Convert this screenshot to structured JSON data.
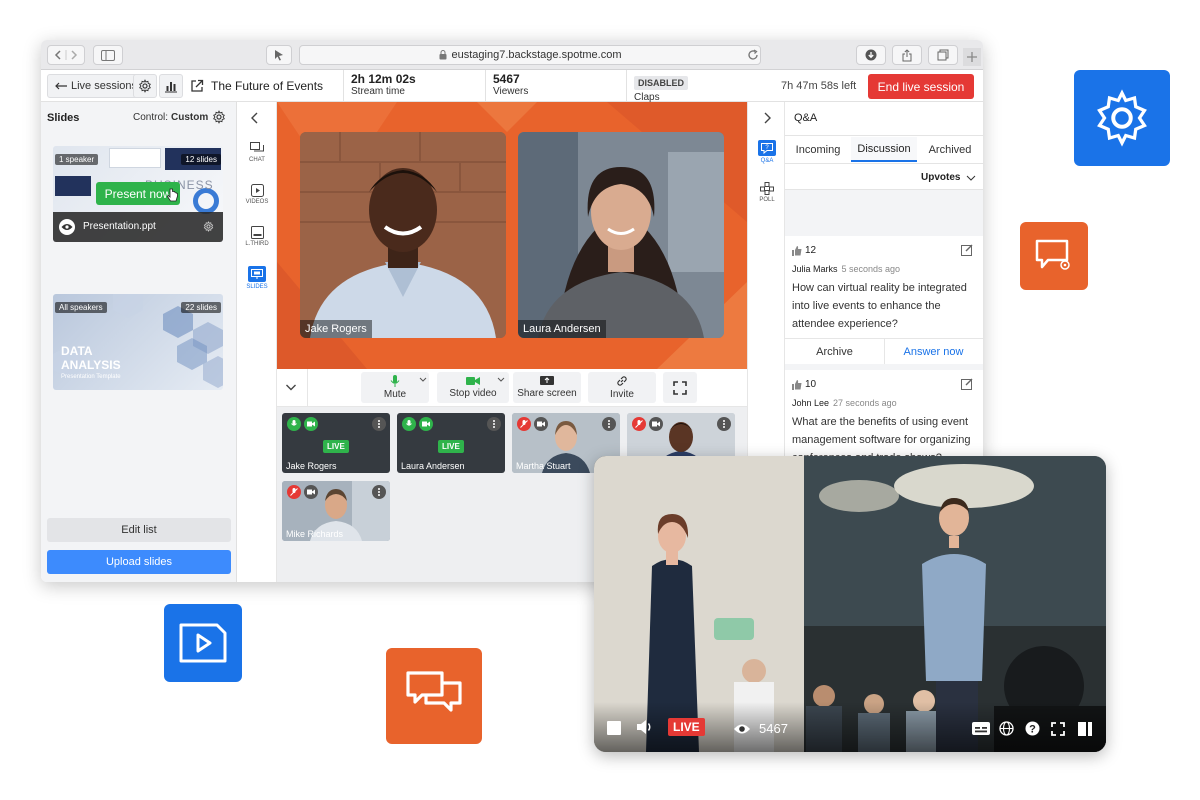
{
  "browser": {
    "url": "eustaging7.backstage.spotme.com"
  },
  "topbar": {
    "back_label": "Live sessions",
    "session_title": "The Future of Events",
    "stream_time_value": "2h 12m 02s",
    "stream_time_label": "Stream time",
    "viewers_value": "5467",
    "viewers_label": "Viewers",
    "claps_badge": "DISABLED",
    "claps_label": "Claps",
    "time_left": "7h 47m 58s left",
    "end_button": "End live session"
  },
  "slides_panel": {
    "title": "Slides",
    "control_label": "Control:",
    "control_value": "Custom",
    "card1": {
      "speakers_pill": "1 speaker",
      "slides_pill": "12 slides",
      "present_button": "Present now",
      "file_name": "Presentation.ppt",
      "thumb_word": "BUSINESS"
    },
    "card2": {
      "speakers_pill": "All speakers",
      "slides_pill": "22 slides",
      "title_line1": "DATA",
      "title_line2": "ANALYSIS",
      "subtitle": "Presentation Template"
    },
    "edit_button": "Edit list",
    "upload_button": "Upload slides"
  },
  "left_rail": {
    "items": [
      "CHAT",
      "VIDEOS",
      "L.THIRD",
      "SLIDES"
    ]
  },
  "stage": {
    "speakers": [
      "Jake Rogers",
      "Laura Andersen"
    ]
  },
  "controls": {
    "mute": "Mute",
    "stop_video": "Stop video",
    "share_screen": "Share screen",
    "invite": "Invite"
  },
  "participants": [
    {
      "name": "Jake Rogers",
      "status": "LIVE"
    },
    {
      "name": "Laura Andersen",
      "status": "LIVE"
    },
    {
      "name": "Martha Stuart",
      "status": ""
    },
    {
      "name": "",
      "status": ""
    },
    {
      "name": "Mike Richards",
      "status": ""
    }
  ],
  "right_rail": {
    "items": [
      "Q&A",
      "POLL"
    ]
  },
  "qa": {
    "title": "Q&A",
    "tabs": [
      "Incoming",
      "Discussion",
      "Archived"
    ],
    "active_tab": "Discussion",
    "sort": "Upvotes",
    "questions": [
      {
        "votes": "12",
        "author": "Julia Marks",
        "time": "5 seconds ago",
        "text": "How can virtual reality be integrated into live events to enhance the attendee experience?",
        "archive": "Archive",
        "answer": "Answer now"
      },
      {
        "votes": "10",
        "author": "John Lee",
        "time": "27 seconds ago",
        "text": "What are the benefits of using event management software for organizing conferences and trade shows?"
      }
    ]
  },
  "event_player": {
    "live_badge": "LIVE",
    "viewer_count": "5467"
  },
  "colors": {
    "accent_blue": "#1a73e8",
    "brand_orange": "#e8632c",
    "live_red": "#e53935",
    "present_green": "#2fb34b"
  }
}
